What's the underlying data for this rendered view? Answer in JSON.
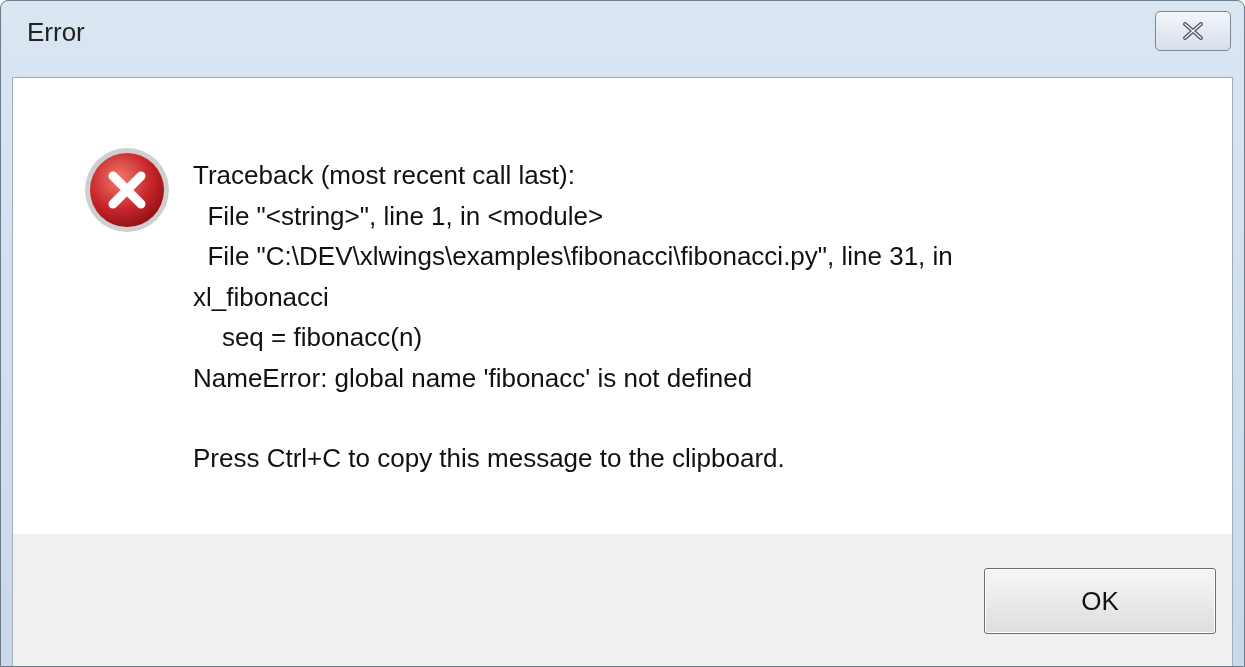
{
  "window": {
    "title": "Error"
  },
  "message": {
    "lines": [
      "Traceback (most recent call last):",
      "  File \"<string>\", line 1, in <module>",
      "  File \"C:\\DEV\\xlwings\\examples\\fibonacci\\fibonacci.py\", line 31, in",
      "xl_fibonacci",
      "    seq = fibonacc(n)",
      "NameError: global name 'fibonacc' is not defined"
    ],
    "hint": "Press Ctrl+C to copy this message to the clipboard."
  },
  "buttons": [
    "OK"
  ]
}
